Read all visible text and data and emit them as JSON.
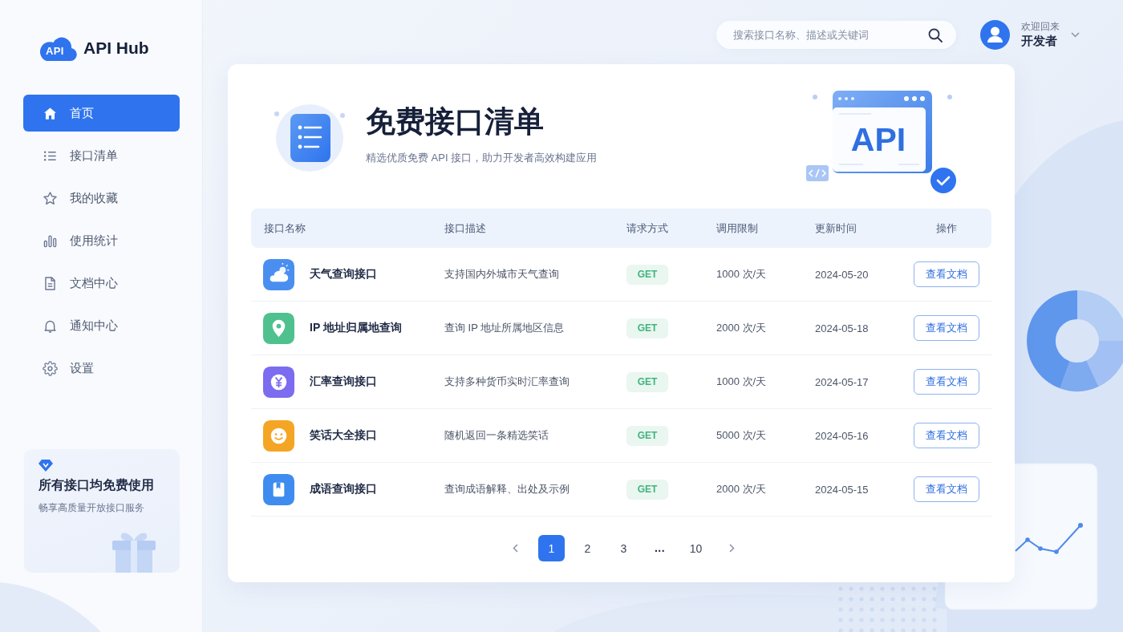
{
  "sidebar": {
    "logo_badge": "API",
    "logo_text": "API Hub",
    "items": [
      {
        "label": "首页",
        "selected": true
      },
      {
        "label": "接口清单",
        "selected": false
      },
      {
        "label": "我的收藏",
        "selected": false
      },
      {
        "label": "使用统计",
        "selected": false
      },
      {
        "label": "文档中心",
        "selected": false
      },
      {
        "label": "通知中心",
        "selected": false
      },
      {
        "label": "设置",
        "selected": false
      }
    ],
    "promo": {
      "title": "所有接口均免费使用",
      "subtitle": "畅享高质量开放接口服务"
    }
  },
  "header": {
    "search": {
      "placeholder": "搜索接口名称、描述或关键词"
    },
    "user": {
      "greeting": "欢迎回来",
      "name": "开发者"
    }
  },
  "hero": {
    "title": "免费接口清单",
    "subtitle": "精选优质免费 API 接口，助力开发者高效构建应用",
    "illustration_text": "API"
  },
  "table": {
    "columns": [
      "接口名称",
      "接口描述",
      "请求方式",
      "调用限制",
      "更新时间",
      "操作"
    ],
    "rows": [
      {
        "name": "天气查询接口",
        "color": "#4a8ff0",
        "description": "支持国内外城市天气查询",
        "method": "GET",
        "limit": "1000 次/天",
        "updated": "2024-05-20",
        "action": "查看文档"
      },
      {
        "name": "IP 地址归属地查询",
        "color": "#4fc18e",
        "description": "查询 IP 地址所属地区信息",
        "method": "GET",
        "limit": "2000 次/天",
        "updated": "2024-05-18",
        "action": "查看文档"
      },
      {
        "name": "汇率查询接口",
        "color": "#7b6cf0",
        "description": "支持多种货币实时汇率查询",
        "method": "GET",
        "limit": "1000 次/天",
        "updated": "2024-05-17",
        "action": "查看文档"
      },
      {
        "name": "笑话大全接口",
        "color": "#f5a524",
        "description": "随机返回一条精选笑话",
        "method": "GET",
        "limit": "5000 次/天",
        "updated": "2024-05-16",
        "action": "查看文档"
      },
      {
        "name": "成语查询接口",
        "color": "#3f8cf0",
        "description": "查询成语解释、出处及示例",
        "method": "GET",
        "limit": "2000 次/天",
        "updated": "2024-05-15",
        "action": "查看文档"
      }
    ]
  },
  "pagination": {
    "pages": [
      {
        "label": "1",
        "kind": "page",
        "selected": true
      },
      {
        "label": "2",
        "kind": "page",
        "selected": false
      },
      {
        "label": "3",
        "kind": "page",
        "selected": false
      },
      {
        "label": "...",
        "kind": "ellipsis",
        "selected": false
      },
      {
        "label": "10",
        "kind": "page",
        "selected": false
      }
    ]
  }
}
